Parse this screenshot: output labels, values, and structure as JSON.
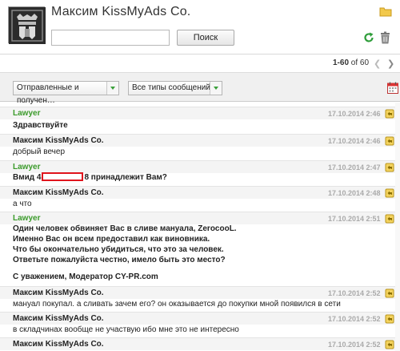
{
  "header": {
    "title": "Максим KissMyAds Co.",
    "search_placeholder": "",
    "search_button": "Поиск"
  },
  "pager": {
    "range": "1-60",
    "of": "of",
    "total": "60"
  },
  "filters": {
    "direction": "Отправленные и получен…",
    "type": "Все типы сообщений"
  },
  "messages": [
    {
      "sender": "Lawyer",
      "date": "17.10.2014 2:46",
      "lines": [
        "Здравствуйте"
      ],
      "bold": true
    },
    {
      "sender": "Максим KissMyAds Co.",
      "date": "17.10.2014 2:46",
      "lines": [
        "добрый вечер"
      ],
      "bold": false
    },
    {
      "sender": "Lawyer",
      "date": "17.10.2014 2:47",
      "text_before": "Вмид 4",
      "text_after": "8 принадлежит Вам?",
      "bold": true
    },
    {
      "sender": "Максим KissMyAds Co.",
      "date": "17.10.2014 2:48",
      "lines": [
        "а что"
      ],
      "bold": false
    },
    {
      "sender": "Lawyer",
      "date": "17.10.2014 2:51",
      "lines": [
        "Один человек обвиняет Вас в сливе мануала, ZerocooL.",
        "Именно Вас он всем предоставил как виновника.",
        "Что бы окончательно убидиться, что это за человек.",
        "Ответьте пожалуйста честно, имело быть это место?",
        "",
        "С уважением, Модератор CY-PR.com"
      ],
      "bold": true
    },
    {
      "sender": "Максим KissMyAds Co.",
      "date": "17.10.2014 2:52",
      "lines": [
        "мануал покупал. а сливать зачем его? он оказывается до покупки мной появился в сети"
      ],
      "bold": false
    },
    {
      "sender": "Максим KissMyAds Co.",
      "date": "17.10.2014 2:52",
      "lines": [
        "в складчинах вообще не участвую ибо мне это не интересно"
      ],
      "bold": false
    },
    {
      "sender": "Максим KissMyAds Co.",
      "date": "17.10.2014 2:52",
      "lines": [],
      "bold": false
    }
  ]
}
